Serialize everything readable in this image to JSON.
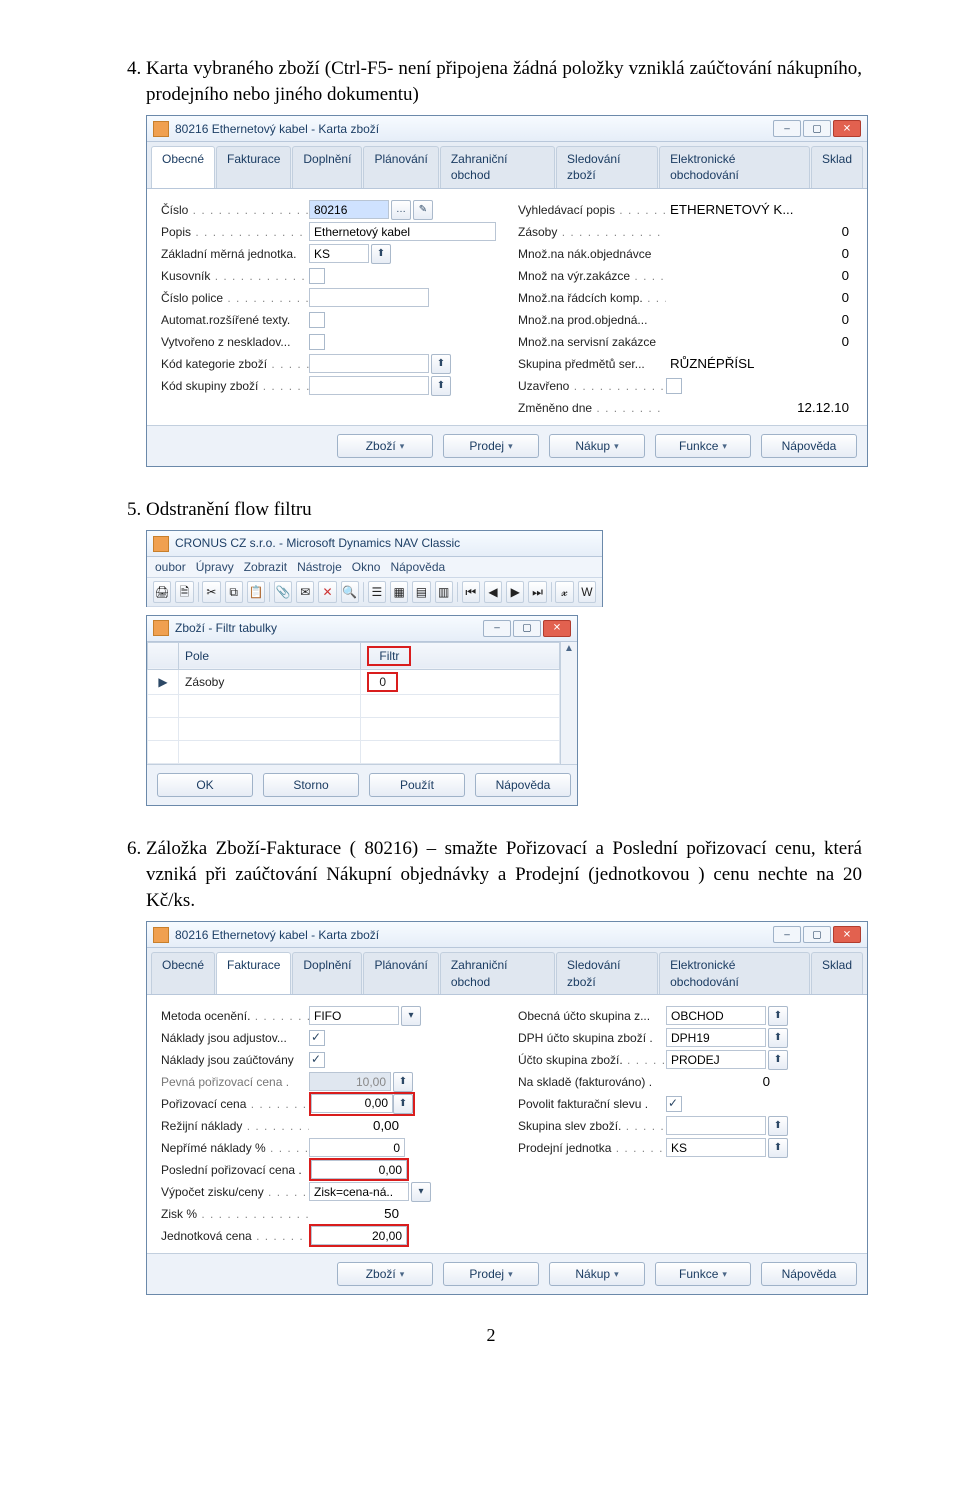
{
  "doc": {
    "item4": "Karta vybraného zboží (Ctrl-F5- není připojena žádná položky vzniklá zaúčtování nákupního, prodejního nebo jiného dokumentu)",
    "item5": "Odstranění flow filtru",
    "item6": "Záložka Zboží-Fakturace ( 80216) – smažte Pořizovací a Poslední pořizovací cenu, která vzniká při zaúčtování Nákupní objednávky  a Prodejní (jednotkovou ) cenu nechte na 20 Kč/ks.",
    "pagenum": "2"
  },
  "cardA": {
    "title": "80216 Ethernetový kabel - Karta zboží",
    "tabs": [
      "Obecné",
      "Fakturace",
      "Doplnění",
      "Plánování",
      "Zahraniční obchod",
      "Sledování zboží",
      "Elektronické obchodování",
      "Sklad"
    ],
    "left": {
      "cislo_l": "Číslo",
      "cislo_v": "80216",
      "popis_l": "Popis",
      "popis_v": "Ethernetový kabel",
      "zmj_l": "Základní měrná jednotka.",
      "zmj_v": "KS",
      "kusovnik_l": "Kusovník",
      "cpolice_l": "Číslo police",
      "art_l": "Automat.rozšířené texty.",
      "vneskl_l": "Vytvořeno z neskladov...",
      "kkat_l": "Kód kategorie zboží",
      "kskup_l": "Kód skupiny zboží"
    },
    "right": {
      "vyhl_l": "Vyhledávací popis",
      "vyhl_v": "ETHERNETOVÝ K...",
      "zas_l": "Zásoby",
      "zas_v": "0",
      "mno_l": "Množ.na nák.objednávce",
      "mno_v": "0",
      "mvz_l": "Množ na výr.zakázce",
      "mvz_v": "0",
      "mrk_l": "Množ.na řádcích komp.",
      "mrk_v": "0",
      "mpo_l": "Množ.na prod.objedná...",
      "mpo_v": "0",
      "msz_l": "Množ.na servisní zakázce",
      "msz_v": "0",
      "sps_l": "Skupina předmětů ser...",
      "sps_v": "RŮZNÉPŘÍSL",
      "uzav_l": "Uzavřeno",
      "zmen_l": "Změněno dne",
      "zmen_v": "12.12.10"
    },
    "buttons": [
      "Zboží",
      "Prodej",
      "Nákup",
      "Funkce",
      "Nápověda"
    ]
  },
  "navWin": {
    "title": "CRONUS CZ s.r.o. - Microsoft Dynamics NAV Classic",
    "menu": [
      "oubor",
      "Úpravy",
      "Zobrazit",
      "Nástroje",
      "Okno",
      "Nápověda"
    ]
  },
  "filterWin": {
    "title": "Zboží - Filtr tabulky",
    "col1": "Pole",
    "col2": "Filtr",
    "row1c1": "Zásoby",
    "row1c2": "0",
    "buttons": [
      "OK",
      "Storno",
      "Použít",
      "Nápověda"
    ]
  },
  "cardB": {
    "title": "80216 Ethernetový kabel - Karta zboží",
    "tabs": [
      "Obecné",
      "Fakturace",
      "Doplnění",
      "Plánování",
      "Zahraniční obchod",
      "Sledování zboží",
      "Elektronické obchodování",
      "Sklad"
    ],
    "left": {
      "met_l": "Metoda ocenění.",
      "met_v": "FIFO",
      "nja_l": "Náklady jsou adjustov...",
      "njz_l": "Náklady jsou zaúčtovány",
      "ppc_l": "Pevná pořizovací cena .",
      "ppc_v": "10,00",
      "poc_l": "Pořizovací cena",
      "poc_v": "0,00",
      "ren_l": "Režijní náklady",
      "ren_v": "0,00",
      "npn_l": "Nepřímé náklady %",
      "npn_v": "0",
      "ppo_l": "Poslední pořizovací cena .",
      "ppo_v": "0,00",
      "vyp_l": "Výpočet zisku/ceny",
      "vyp_v": "Zisk=cena-ná..",
      "zisk_l": "Zisk %",
      "zisk_v": "50",
      "jc_l": "Jednotková cena",
      "jc_v": "20,00"
    },
    "right": {
      "ous_l": "Obecná účto skupina z...",
      "ous_v": "OBCHOD",
      "dph_l": "DPH účto skupina zboží .",
      "dph_v": "DPH19",
      "usz_l": "Účto skupina zboží.",
      "usz_v": "PRODEJ",
      "nsf_l": "Na skladě (fakturováno) .",
      "nsf_v": "0",
      "pfs_l": "Povolit fakturační slevu .",
      "ssz_l": "Skupina slev zboží.",
      "pj_l": "Prodejní jednotka",
      "pj_v": "KS"
    },
    "buttons": [
      "Zboží",
      "Prodej",
      "Nákup",
      "Funkce",
      "Nápověda"
    ]
  }
}
